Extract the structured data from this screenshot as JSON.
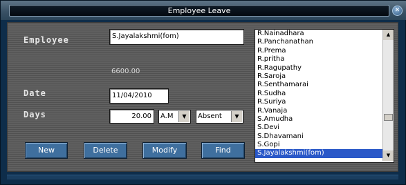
{
  "window": {
    "title": "Employee Leave",
    "close_icon": "✕"
  },
  "form": {
    "employee_label": "Employee",
    "employee_value": "S.Jayalakshmi(fom)",
    "salary": "6600.00",
    "date_label": "Date",
    "date_value": "11/04/2010",
    "days_label": "Days",
    "days_value": "20.00",
    "session_value": "A.M",
    "status_value": "Absent",
    "dropdown_arrow": "▼"
  },
  "buttons": {
    "new": "New",
    "delete": "Delete",
    "modify": "Modify",
    "find": "Find"
  },
  "employee_list": {
    "items": [
      "R.Nainadhara",
      "R.Panchanathan",
      "R.Prema",
      "R.pritha",
      "R.Ragupathy",
      "R.Saroja",
      "R.Senthamarai",
      "R.Sudha",
      "R.Suriya",
      "R.Vanaja",
      "S.Amudha",
      "S.Devi",
      "S.Dhavamani",
      "S.Gopi",
      "S.Jayalakshmi(fom)"
    ],
    "selected_index": 14,
    "scroll_up": "▲",
    "scroll_down": "▼"
  },
  "colors": {
    "title_bg": "#0a1420",
    "panel_bg": "#606060",
    "button_bg": "#3f6f9e",
    "selection": "#2a58c8"
  }
}
